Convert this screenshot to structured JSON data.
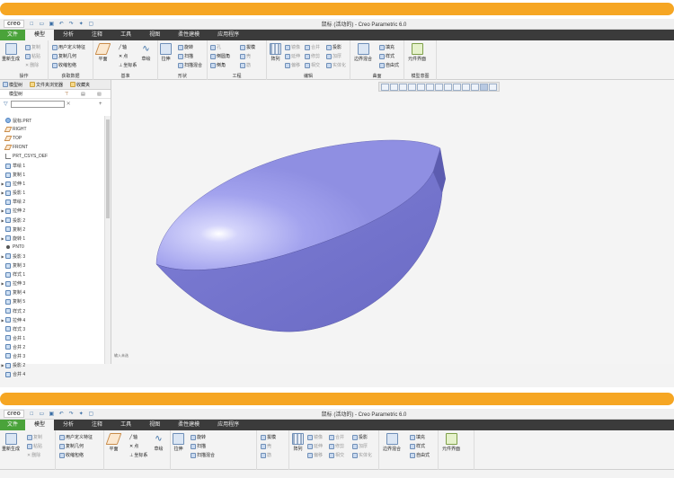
{
  "window": {
    "logo": "creo",
    "title": "鼠标 (活动的) - Creo Parametric 6.0"
  },
  "tabs": [
    "文件",
    "模型",
    "分析",
    "注释",
    "工具",
    "视图",
    "柔性建模",
    "应用程序"
  ],
  "ribbon": {
    "operations": {
      "regenerate": "重新生成",
      "copy": "复制",
      "paste": "粘贴",
      "delete": "删除",
      "label": "操作"
    },
    "get_data": {
      "udf": "用户定义特征",
      "copy_geom": "复制几何",
      "shrinkwrap": "收缩包络",
      "label": "获取数据"
    },
    "datum": {
      "plane": "平面",
      "axis": "轴",
      "point": "点",
      "csys": "坐标系",
      "sketch": "草绘",
      "label": "基准"
    },
    "shapes": {
      "extrude": "拉伸",
      "revolve": "旋转",
      "sweep": "扫描",
      "swept_blend": "扫描混合",
      "label": "形状"
    },
    "engineering": {
      "hole": "孔",
      "round": "倒圆角",
      "chamfer": "倒角",
      "draft": "拔模",
      "shell": "壳",
      "rib": "筋",
      "label": "工程"
    },
    "editing": {
      "pattern": "阵列",
      "mirror": "镜像",
      "extend": "延伸",
      "trim": "修剪",
      "offset": "偏移",
      "merge": "合并",
      "intersect": "相交",
      "thicken": "加厚",
      "solidify": "实体化",
      "project": "投影",
      "label": "编辑"
    },
    "surfaces": {
      "boundary_blend": "边界混合",
      "fill": "填充",
      "style": "样式",
      "freestyle": "自由式",
      "label": "曲面"
    },
    "model_intent": {
      "element_view": "元件界面",
      "label": "模型意图"
    }
  },
  "panel": {
    "tabs": [
      "模型树",
      "文件夹浏览器",
      "收藏夹"
    ],
    "header": "模型树"
  },
  "tree": [
    {
      "label": "鼠标.PRT",
      "icon": "part",
      "arrow": ""
    },
    {
      "label": "RIGHT",
      "icon": "plane",
      "arrow": ""
    },
    {
      "label": "TOP",
      "icon": "plane",
      "arrow": ""
    },
    {
      "label": "FRONT",
      "icon": "plane",
      "arrow": ""
    },
    {
      "label": "PRT_CSYS_DEF",
      "icon": "csys",
      "arrow": ""
    },
    {
      "label": "草绘 1",
      "icon": "feat",
      "arrow": ""
    },
    {
      "label": "复制 1",
      "icon": "feat",
      "arrow": ""
    },
    {
      "label": "拉伸 1",
      "icon": "feat",
      "arrow": "▶"
    },
    {
      "label": "投影 1",
      "icon": "feat",
      "arrow": "▶"
    },
    {
      "label": "草绘 2",
      "icon": "feat",
      "arrow": ""
    },
    {
      "label": "拉伸 2",
      "icon": "feat",
      "arrow": "▶"
    },
    {
      "label": "投影 2",
      "icon": "feat",
      "arrow": "▶"
    },
    {
      "label": "复制 2",
      "icon": "feat",
      "arrow": ""
    },
    {
      "label": "旋转 1",
      "icon": "feat",
      "arrow": "▶"
    },
    {
      "label": "PNT0",
      "icon": "pnt",
      "arrow": ""
    },
    {
      "label": "投影 3",
      "icon": "feat",
      "arrow": "▶"
    },
    {
      "label": "复制 3",
      "icon": "feat",
      "arrow": ""
    },
    {
      "label": "样式 1",
      "icon": "feat",
      "arrow": ""
    },
    {
      "label": "拉伸 3",
      "icon": "feat",
      "arrow": "▶"
    },
    {
      "label": "复制 4",
      "icon": "feat",
      "arrow": ""
    },
    {
      "label": "复制 5",
      "icon": "feat",
      "arrow": ""
    },
    {
      "label": "样式 2",
      "icon": "feat",
      "arrow": ""
    },
    {
      "label": "拉伸 4",
      "icon": "feat",
      "arrow": "▶"
    },
    {
      "label": "样式 3",
      "icon": "feat",
      "arrow": ""
    },
    {
      "label": "合并 1",
      "icon": "feat",
      "arrow": ""
    },
    {
      "label": "合并 2",
      "icon": "feat",
      "arrow": ""
    },
    {
      "label": "合并 3",
      "icon": "feat",
      "arrow": ""
    },
    {
      "label": "投影 2",
      "icon": "feat",
      "arrow": "▶"
    },
    {
      "label": "合并 4",
      "icon": "feat",
      "arrow": ""
    }
  ],
  "viewport": {
    "status": "输入未选"
  },
  "colors": {
    "band": "#f6a623",
    "file_tab": "#4aa33a",
    "model": "#9f9fe8"
  }
}
